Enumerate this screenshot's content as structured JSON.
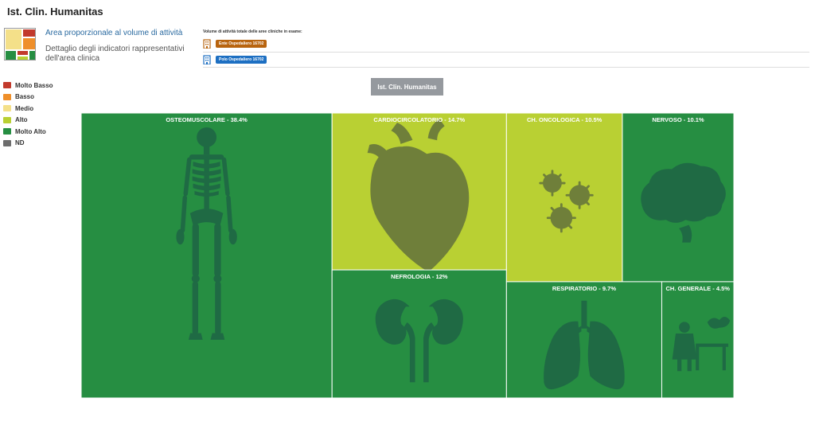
{
  "page": {
    "title": "Ist. Clin. Humanitas"
  },
  "header_legend": {
    "line1": "Area proporzionale al volume di attività",
    "line2": "Dettaglio degli indicatori rappresentativi dell'area clinica"
  },
  "volume": {
    "title": "Volume di attività totale delle aree cliniche in esame:",
    "ente_label": "Ente Ospedaliero 16702",
    "polo_label": "Polo Ospedaliero 16702",
    "ente_color": "#b8640f",
    "polo_color": "#1d6fc2"
  },
  "legend": {
    "items": [
      {
        "label": "Molto Basso",
        "color": "#c23a2c"
      },
      {
        "label": "Basso",
        "color": "#ef8f2a"
      },
      {
        "label": "Medio",
        "color": "#f4e089"
      },
      {
        "label": "Alto",
        "color": "#b9d033"
      },
      {
        "label": "Molto Alto",
        "color": "#268e42"
      },
      {
        "label": "ND",
        "color": "#6d6d6d"
      }
    ]
  },
  "root_button": {
    "label": "Ist. Clin. Humanitas"
  },
  "chart_data": {
    "type": "treemap",
    "root": "Ist. Clin. Humanitas",
    "unit": "%",
    "values_shown": [
      {
        "name": "OSTEOMUSCOLARE",
        "value": 38.4,
        "label": "OSTEOMUSCOLARE - 38.4%",
        "level": "Molto Alto",
        "color": "#268e42",
        "icon": "skeleton-icon"
      },
      {
        "name": "CARDIOCIRCOLATORIO",
        "value": 14.7,
        "label": "CARDIOCIRCOLATORIO - 14.7%",
        "level": "Alto",
        "color": "#b9d033",
        "icon": "heart-icon"
      },
      {
        "name": "NEFROLOGIA",
        "value": 12,
        "label": "NEFROLOGIA - 12%",
        "level": "Molto Alto",
        "color": "#268e42",
        "icon": "kidneys-icon"
      },
      {
        "name": "CH. ONCOLOGICA",
        "value": 10.5,
        "label": "CH. ONCOLOGICA - 10.5%",
        "level": "Alto",
        "color": "#b9d033",
        "icon": "cells-icon"
      },
      {
        "name": "NERVOSO",
        "value": 10.1,
        "label": "NERVOSO - 10.1%",
        "level": "Molto Alto",
        "color": "#268e42",
        "icon": "brain-icon"
      },
      {
        "name": "RESPIRATORIO",
        "value": 9.7,
        "label": "RESPIRATORIO - 9.7%",
        "level": "Molto Alto",
        "color": "#268e42",
        "icon": "lungs-icon"
      },
      {
        "name": "CH. GENERALE",
        "value": 4.5,
        "label": "CH. GENERALE - 4.5%",
        "level": "Molto Alto",
        "color": "#268e42",
        "icon": "surgeon-icon"
      }
    ]
  }
}
